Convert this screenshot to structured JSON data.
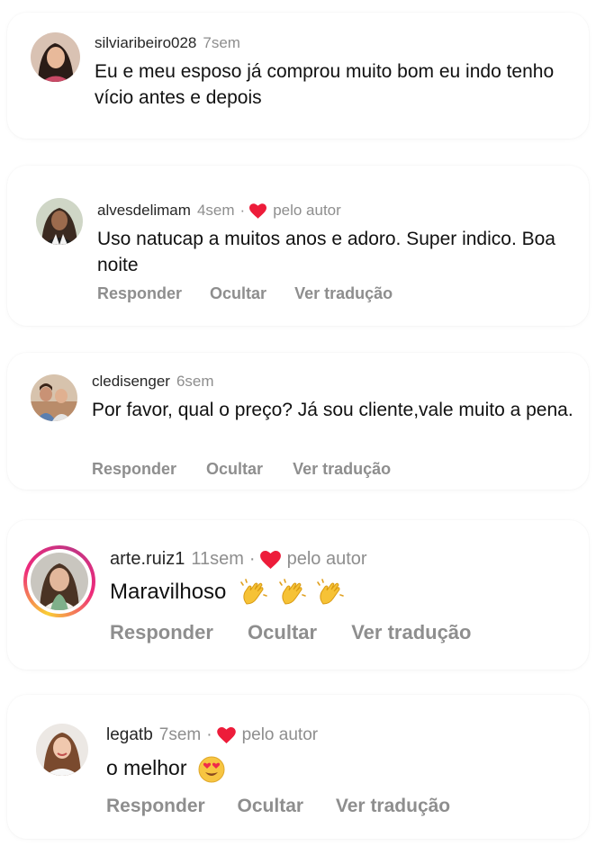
{
  "comments": [
    {
      "username": "silviaribeiro028",
      "time": "7sem",
      "text": "Eu e meu esposo já comprou muito bom eu indo tenho vício antes e depois",
      "liked_by_author": false
    },
    {
      "username": "alvesdelimam",
      "time": "4sem",
      "separator": "·",
      "author_label": "pelo autor",
      "text": "Uso natucap a muitos anos e adoro. Super indico. Boa noite",
      "actions": [
        "Responder",
        "Ocultar",
        "Ver tradução"
      ],
      "liked_by_author": true
    },
    {
      "username": "cledisenger",
      "time": "6sem",
      "text": "Por favor, qual o preço? Já sou cliente,vale muito a pena.",
      "actions": [
        "Responder",
        "Ocultar",
        "Ver tradução"
      ],
      "liked_by_author": false
    },
    {
      "username": "arte.ruiz1",
      "time": "11sem",
      "separator": "·",
      "author_label": "pelo autor",
      "text": "Maravilhoso",
      "emoji": [
        "clapping-hands",
        "clapping-hands",
        "clapping-hands"
      ],
      "actions": [
        "Responder",
        "Ocultar",
        "Ver tradução"
      ],
      "liked_by_author": true,
      "story_ring": true
    },
    {
      "username": "legatb",
      "time": "7sem",
      "separator": "·",
      "author_label": "pelo autor",
      "text": "o melhor",
      "emoji": [
        "heart-eyes"
      ],
      "actions": [
        "Responder",
        "Ocultar",
        "Ver tradução"
      ],
      "liked_by_author": true
    }
  ],
  "colors": {
    "heart": "#ed1c3a",
    "muted_text": "#8e8e8e",
    "story_ring": [
      "#f9ce34",
      "#ee2a7b",
      "#c13584"
    ]
  }
}
